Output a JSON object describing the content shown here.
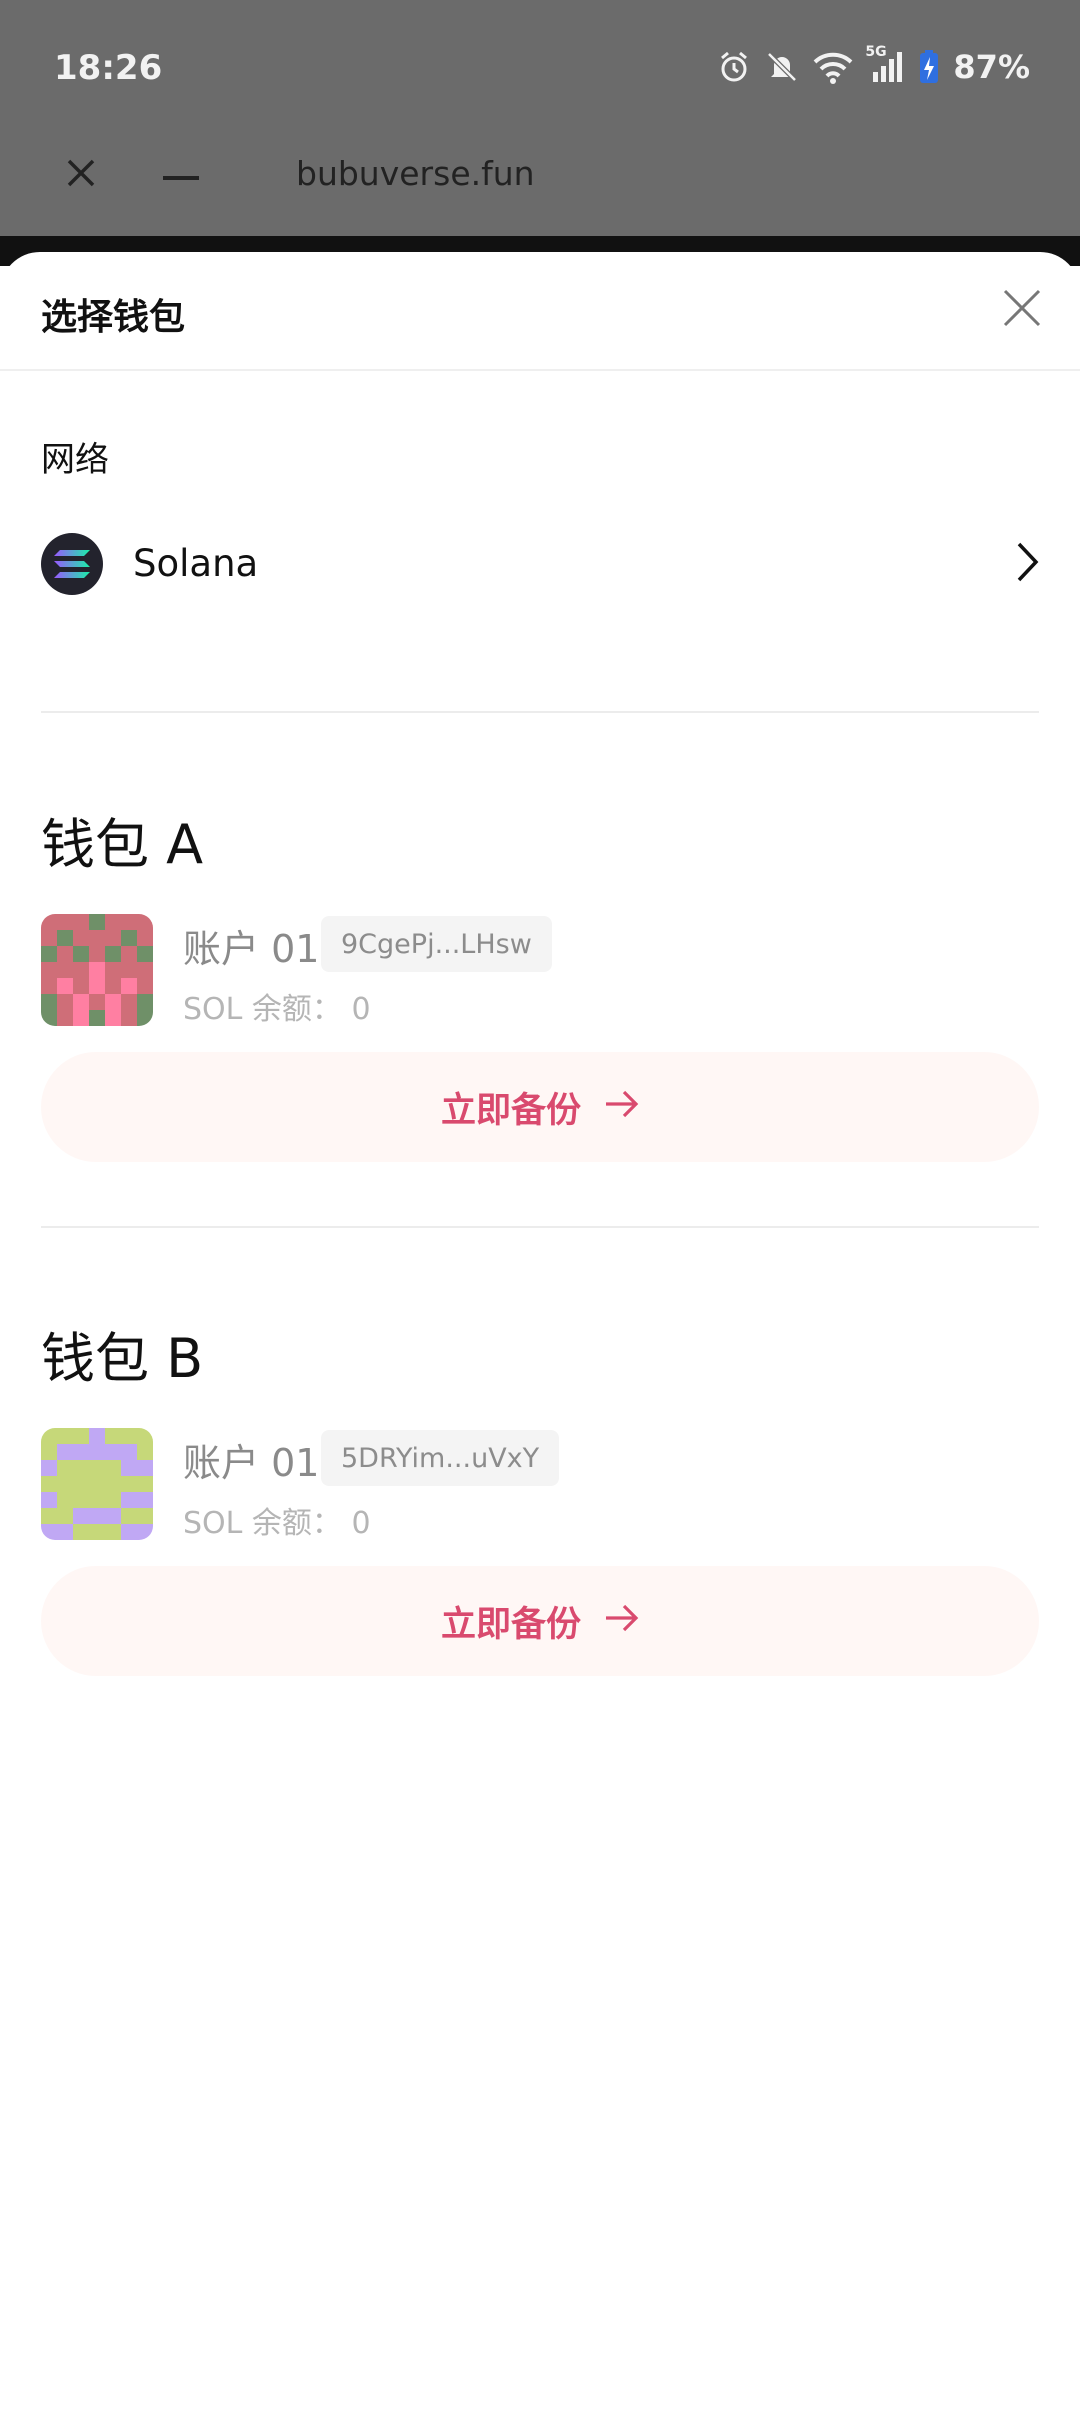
{
  "status_bar": {
    "time": "18:26",
    "network_type": "5G",
    "battery": "87%"
  },
  "browser": {
    "url": "bubuverse.fun"
  },
  "sheet": {
    "title": "选择钱包",
    "network_label": "网络",
    "network_name": "Solana"
  },
  "wallets": [
    {
      "title": "钱包 A",
      "account_name": "账户 01",
      "address": "9CgePj...LHsw",
      "balance": "SOL 余额： 0",
      "backup_label": "立即备份"
    },
    {
      "title": "钱包 B",
      "account_name": "账户 01",
      "address": "5DRYim...uVxY",
      "balance": "SOL 余额： 0",
      "backup_label": "立即备份"
    }
  ],
  "colors": {
    "accent": "#d94a6e",
    "backup_bg": "#fff7f5",
    "dim_overlay": "#6b6b6b"
  }
}
